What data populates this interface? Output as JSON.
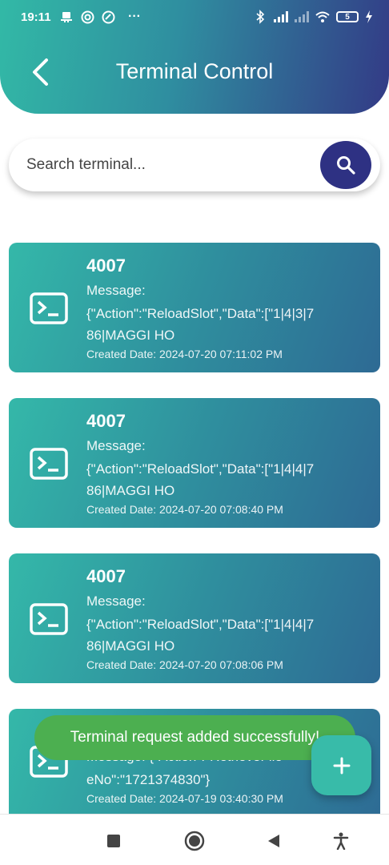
{
  "status_bar": {
    "time": "19:11",
    "left_icons": [
      "notification-icon",
      "circle-app-icon",
      "circle-app-icon",
      "more-dots-icon"
    ],
    "more": "···",
    "battery_level": "5"
  },
  "header": {
    "title": "Terminal Control",
    "back_icon": "chevron-left-icon"
  },
  "search": {
    "placeholder": "Search terminal...",
    "button_icon": "search-icon"
  },
  "cards": [
    {
      "id": "4007",
      "message_label": "Message:",
      "message": "{\"Action\":\"ReloadSlot\",\"Data\":[\"1|4|3|786|MAGGI HO",
      "date": "Created Date: 2024-07-20 07:11:02 PM"
    },
    {
      "id": "4007",
      "message_label": "Message:",
      "message": "{\"Action\":\"ReloadSlot\",\"Data\":[\"1|4|4|786|MAGGI HO",
      "date": "Created Date: 2024-07-20 07:08:40 PM"
    },
    {
      "id": "4007",
      "message_label": "Message:",
      "message": "{\"Action\":\"ReloadSlot\",\"Data\":[\"1|4|4|786|MAGGI HO",
      "date": "Created Date: 2024-07-20 07:08:06 PM"
    },
    {
      "message_label": "Message: {\"Action\":\"RetrieveFile",
      "message": "eNo\":\"1721374830\"}",
      "date": "Created Date: 2024-07-19 03:40:30 PM"
    }
  ],
  "toast": {
    "text": "Terminal request added successfully!"
  },
  "fab": {
    "icon": "plus-icon"
  },
  "navbar": {
    "icons": [
      "recent-apps-icon",
      "home-icon",
      "back-icon",
      "accessibility-icon"
    ]
  },
  "colors": {
    "header_start": "#32b9a6",
    "header_end": "#333a86",
    "search_button": "#2e3183",
    "toast": "#4caf50",
    "fab": "#38bba9"
  }
}
